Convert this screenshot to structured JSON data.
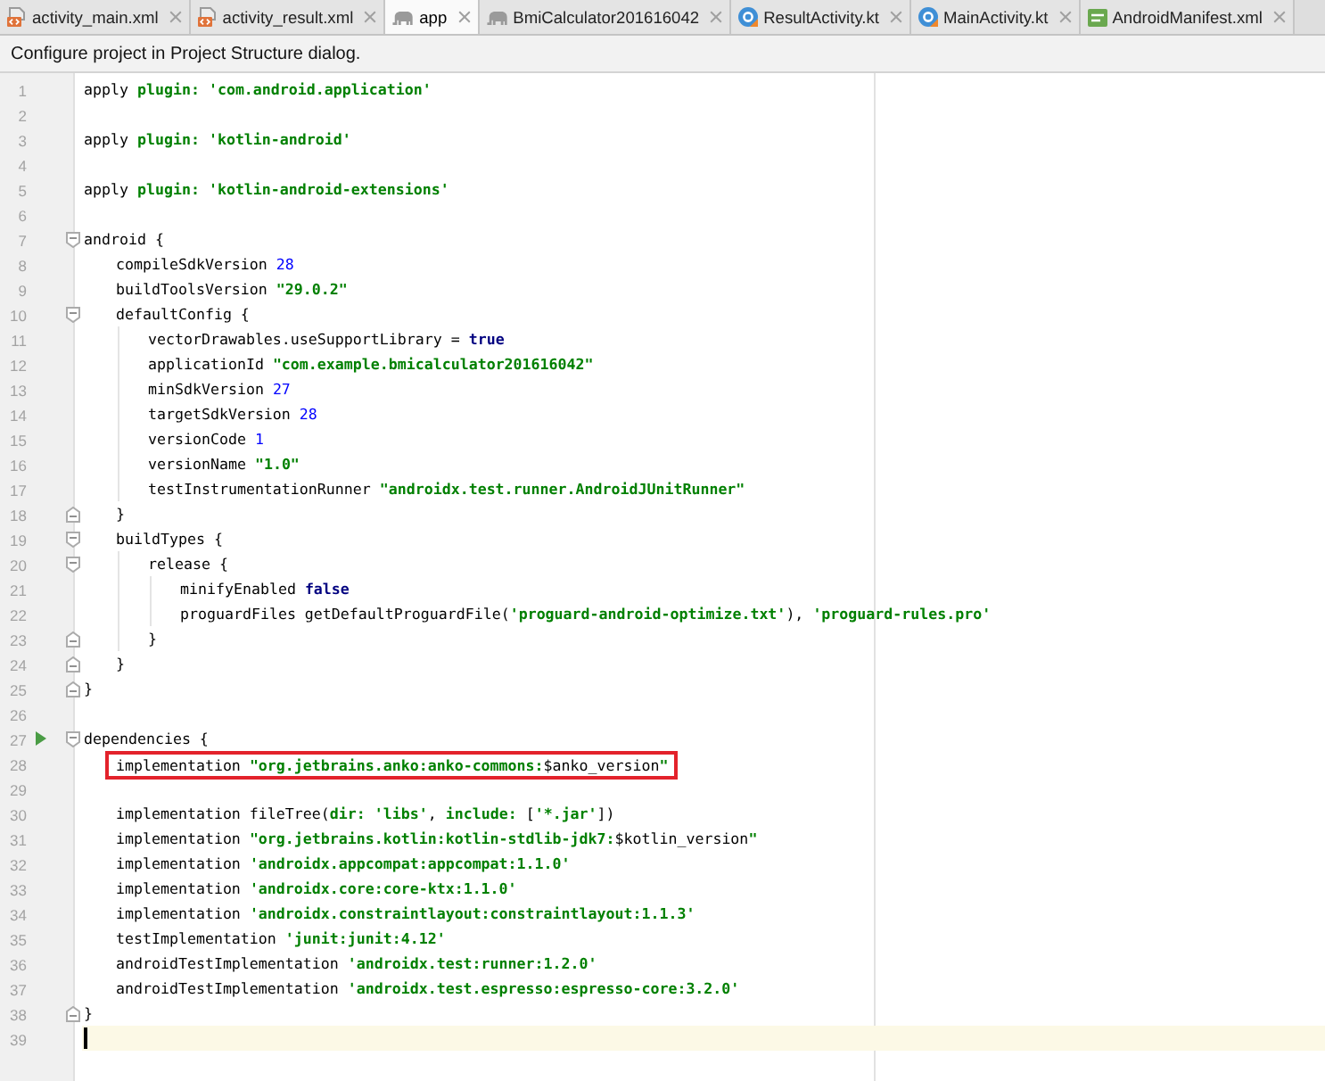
{
  "tabs": [
    {
      "label": "activity_main.xml",
      "kind": "xml",
      "selected": false
    },
    {
      "label": "activity_result.xml",
      "kind": "xml",
      "selected": false
    },
    {
      "label": "app",
      "kind": "gradle",
      "selected": true
    },
    {
      "label": "BmiCalculator201616042",
      "kind": "gradle",
      "selected": false
    },
    {
      "label": "ResultActivity.kt",
      "kind": "kotlin",
      "selected": false
    },
    {
      "label": "MainActivity.kt",
      "kind": "kotlin",
      "selected": false
    },
    {
      "label": "AndroidManifest.xml",
      "kind": "manifest",
      "selected": false
    }
  ],
  "banner": {
    "text": "Configure project in Project Structure dialog."
  },
  "editor": {
    "lines": [
      {
        "number": "1",
        "kind": "plain",
        "tokens": [
          {
            "kind": "plain",
            "text": "apply "
          },
          {
            "kind": "label",
            "text": "plugin: "
          },
          {
            "kind": "string",
            "text": "'com.android.application'"
          }
        ],
        "current": false,
        "boxed": false,
        "run_marker": false
      },
      {
        "number": "2",
        "kind": "plain",
        "current": false,
        "boxed": false,
        "run_marker": false
      },
      {
        "number": "3",
        "kind": "plain",
        "tokens": [
          {
            "kind": "plain",
            "text": "apply "
          },
          {
            "kind": "label",
            "text": "plugin: "
          },
          {
            "kind": "string",
            "text": "'kotlin-android'"
          }
        ],
        "current": false,
        "boxed": false,
        "run_marker": false
      },
      {
        "number": "4",
        "kind": "plain",
        "current": false,
        "boxed": false,
        "run_marker": false
      },
      {
        "number": "5",
        "kind": "plain",
        "tokens": [
          {
            "kind": "plain",
            "text": "apply "
          },
          {
            "kind": "label",
            "text": "plugin: "
          },
          {
            "kind": "string",
            "text": "'kotlin-android-extensions'"
          }
        ],
        "current": false,
        "boxed": false,
        "run_marker": false
      },
      {
        "number": "6",
        "kind": "plain",
        "current": false,
        "boxed": false,
        "run_marker": false
      },
      {
        "number": "7",
        "kind": "block_start",
        "tokens": [
          {
            "kind": "plain",
            "text": "android {"
          }
        ],
        "current": false,
        "boxed": false,
        "run_marker": false,
        "children": [
          {
            "number": "8",
            "kind": "plain",
            "tokens": [
              {
                "kind": "plain",
                "text": "compileSdkVersion "
              },
              {
                "kind": "number",
                "text": "28"
              }
            ],
            "current": false,
            "boxed": false,
            "run_marker": false
          },
          {
            "number": "9",
            "kind": "plain",
            "tokens": [
              {
                "kind": "plain",
                "text": "buildToolsVersion "
              },
              {
                "kind": "string",
                "text": "\"29.0.2\""
              }
            ],
            "current": false,
            "boxed": false,
            "run_marker": false
          },
          {
            "number": "10",
            "kind": "block_start",
            "tokens": [
              {
                "kind": "plain",
                "text": "defaultConfig {"
              }
            ],
            "current": false,
            "boxed": false,
            "run_marker": false,
            "children": [
              {
                "number": "11",
                "kind": "plain",
                "tokens": [
                  {
                    "kind": "plain",
                    "text": "vectorDrawables.useSupportLibrary = "
                  },
                  {
                    "kind": "keyword",
                    "text": "true"
                  }
                ],
                "current": false,
                "boxed": false,
                "run_marker": false
              },
              {
                "number": "12",
                "kind": "plain",
                "tokens": [
                  {
                    "kind": "plain",
                    "text": "applicationId "
                  },
                  {
                    "kind": "string",
                    "text": "\"com.example.bmicalculator201616042\""
                  }
                ],
                "current": false,
                "boxed": false,
                "run_marker": false
              },
              {
                "number": "13",
                "kind": "plain",
                "tokens": [
                  {
                    "kind": "plain",
                    "text": "minSdkVersion "
                  },
                  {
                    "kind": "number",
                    "text": "27"
                  }
                ],
                "current": false,
                "boxed": false,
                "run_marker": false
              },
              {
                "number": "14",
                "kind": "plain",
                "tokens": [
                  {
                    "kind": "plain",
                    "text": "targetSdkVersion "
                  },
                  {
                    "kind": "number",
                    "text": "28"
                  }
                ],
                "current": false,
                "boxed": false,
                "run_marker": false
              },
              {
                "number": "15",
                "kind": "plain",
                "tokens": [
                  {
                    "kind": "plain",
                    "text": "versionCode "
                  },
                  {
                    "kind": "number",
                    "text": "1"
                  }
                ],
                "current": false,
                "boxed": false,
                "run_marker": false
              },
              {
                "number": "16",
                "kind": "plain",
                "tokens": [
                  {
                    "kind": "plain",
                    "text": "versionName "
                  },
                  {
                    "kind": "string",
                    "text": "\"1.0\""
                  }
                ],
                "current": false,
                "boxed": false,
                "run_marker": false
              },
              {
                "number": "17",
                "kind": "plain",
                "tokens": [
                  {
                    "kind": "plain",
                    "text": "testInstrumentationRunner "
                  },
                  {
                    "kind": "string",
                    "text": "\"androidx.test.runner.AndroidJUnitRunner\""
                  }
                ],
                "current": false,
                "boxed": false,
                "run_marker": false
              }
            ]
          },
          {
            "number": "18",
            "kind": "block_end",
            "tokens": [
              {
                "kind": "plain",
                "text": "}"
              }
            ],
            "current": false,
            "boxed": false,
            "run_marker": false
          },
          {
            "number": "19",
            "kind": "block_start",
            "tokens": [
              {
                "kind": "plain",
                "text": "buildTypes {"
              }
            ],
            "current": false,
            "boxed": false,
            "run_marker": false,
            "children": [
              {
                "number": "20",
                "kind": "block_start",
                "tokens": [
                  {
                    "kind": "plain",
                    "text": "release {"
                  }
                ],
                "current": false,
                "boxed": false,
                "run_marker": false,
                "children": [
                  {
                    "number": "21",
                    "kind": "plain",
                    "tokens": [
                      {
                        "kind": "plain",
                        "text": "minifyEnabled "
                      },
                      {
                        "kind": "keyword",
                        "text": "false"
                      }
                    ],
                    "current": false,
                    "boxed": false,
                    "run_marker": false
                  },
                  {
                    "number": "22",
                    "kind": "plain",
                    "tokens": [
                      {
                        "kind": "plain",
                        "text": "proguardFiles getDefaultProguardFile("
                      },
                      {
                        "kind": "string",
                        "text": "'proguard-android-optimize.txt'"
                      },
                      {
                        "kind": "plain",
                        "text": "), "
                      },
                      {
                        "kind": "string",
                        "text": "'proguard-rules.pro'"
                      }
                    ],
                    "current": false,
                    "boxed": false,
                    "run_marker": false
                  }
                ]
              },
              {
                "number": "23",
                "kind": "block_end",
                "tokens": [
                  {
                    "kind": "plain",
                    "text": "}"
                  }
                ],
                "current": false,
                "boxed": false,
                "run_marker": false
              }
            ]
          },
          {
            "number": "24",
            "kind": "block_end",
            "tokens": [
              {
                "kind": "plain",
                "text": "}"
              }
            ],
            "current": false,
            "boxed": false,
            "run_marker": false
          }
        ]
      },
      {
        "number": "25",
        "kind": "block_end",
        "tokens": [
          {
            "kind": "plain",
            "text": "}"
          }
        ],
        "current": false,
        "boxed": false,
        "run_marker": false
      },
      {
        "number": "26",
        "kind": "plain",
        "current": false,
        "boxed": false,
        "run_marker": false
      },
      {
        "number": "27",
        "kind": "block_start",
        "tokens": [
          {
            "kind": "plain",
            "text": "dependencies {"
          }
        ],
        "current": false,
        "boxed": false,
        "run_marker": true,
        "children": [
          {
            "number": "28",
            "kind": "plain",
            "tokens": [
              {
                "kind": "plain",
                "text": "implementation "
              },
              {
                "kind": "string",
                "text": "\"org.jetbrains.anko:anko-commons:"
              },
              {
                "kind": "plain",
                "text": "$anko_version"
              },
              {
                "kind": "string",
                "text": "\""
              }
            ],
            "current": false,
            "boxed": true,
            "run_marker": false
          },
          {
            "number": "29",
            "kind": "plain",
            "current": false,
            "boxed": false,
            "run_marker": false
          },
          {
            "number": "30",
            "kind": "plain",
            "tokens": [
              {
                "kind": "plain",
                "text": "implementation fileTree("
              },
              {
                "kind": "label",
                "text": "dir: "
              },
              {
                "kind": "string",
                "text": "'libs'"
              },
              {
                "kind": "plain",
                "text": ", "
              },
              {
                "kind": "label",
                "text": "include: "
              },
              {
                "kind": "plain",
                "text": "["
              },
              {
                "kind": "string",
                "text": "'*.jar'"
              },
              {
                "kind": "plain",
                "text": "])"
              }
            ],
            "current": false,
            "boxed": false,
            "run_marker": false
          },
          {
            "number": "31",
            "kind": "plain",
            "tokens": [
              {
                "kind": "plain",
                "text": "implementation "
              },
              {
                "kind": "string",
                "text": "\"org.jetbrains.kotlin:kotlin-stdlib-jdk7:"
              },
              {
                "kind": "plain",
                "text": "$kotlin_version"
              },
              {
                "kind": "string",
                "text": "\""
              }
            ],
            "current": false,
            "boxed": false,
            "run_marker": false
          },
          {
            "number": "32",
            "kind": "plain",
            "tokens": [
              {
                "kind": "plain",
                "text": "implementation "
              },
              {
                "kind": "string",
                "text": "'androidx.appcompat:appcompat:1.1.0'"
              }
            ],
            "current": false,
            "boxed": false,
            "run_marker": false
          },
          {
            "number": "33",
            "kind": "plain",
            "tokens": [
              {
                "kind": "plain",
                "text": "implementation "
              },
              {
                "kind": "string",
                "text": "'androidx.core:core-ktx:1.1.0'"
              }
            ],
            "current": false,
            "boxed": false,
            "run_marker": false
          },
          {
            "number": "34",
            "kind": "plain",
            "tokens": [
              {
                "kind": "plain",
                "text": "implementation "
              },
              {
                "kind": "string",
                "text": "'androidx.constraintlayout:constraintlayout:1.1.3'"
              }
            ],
            "current": false,
            "boxed": false,
            "run_marker": false
          },
          {
            "number": "35",
            "kind": "plain",
            "tokens": [
              {
                "kind": "plain",
                "text": "testImplementation "
              },
              {
                "kind": "string",
                "text": "'junit:junit:4.12'"
              }
            ],
            "current": false,
            "boxed": false,
            "run_marker": false
          },
          {
            "number": "36",
            "kind": "plain",
            "tokens": [
              {
                "kind": "plain",
                "text": "androidTestImplementation "
              },
              {
                "kind": "string",
                "text": "'androidx.test:runner:1.2.0'"
              }
            ],
            "current": false,
            "boxed": false,
            "run_marker": false
          },
          {
            "number": "37",
            "kind": "plain",
            "tokens": [
              {
                "kind": "plain",
                "text": "androidTestImplementation "
              },
              {
                "kind": "string",
                "text": "'androidx.test.espresso:espresso-core:3.2.0'"
              }
            ],
            "current": false,
            "boxed": false,
            "run_marker": false
          }
        ]
      },
      {
        "number": "38",
        "kind": "block_end",
        "tokens": [
          {
            "kind": "plain",
            "text": "}"
          }
        ],
        "current": false,
        "boxed": false,
        "run_marker": false
      },
      {
        "number": "39",
        "kind": "plain",
        "current": true,
        "boxed": false,
        "run_marker": false
      }
    ]
  }
}
